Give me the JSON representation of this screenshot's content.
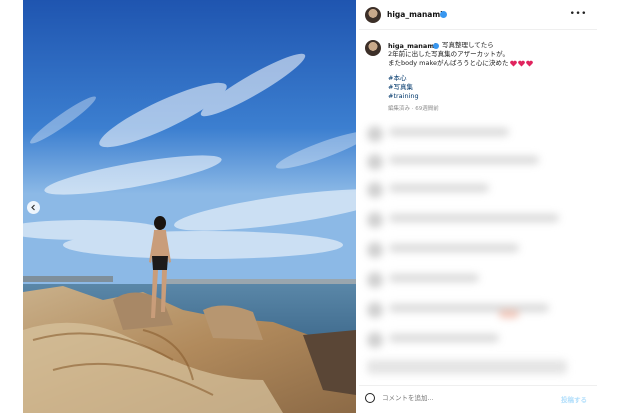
{
  "post": {
    "username": "higa_manami",
    "caption_lines": [
      "写真整理してたら",
      "2年前に出した写真集のアザーカットが。",
      "またbody makeがんばろうと心に決めた"
    ],
    "hashtags": [
      "#本心",
      "#写真集",
      "#training"
    ],
    "meta": "編集済み · 69週間前"
  },
  "header": {
    "more_icon": "more-horizontal-icon",
    "more_label": "•••"
  },
  "footer": {
    "comment_placeholder": "コメントを追加...",
    "post_label": "投稿する",
    "emoji_icon": "emoji-smiley-icon"
  },
  "colors": {
    "link": "#00376b",
    "verified": "#3897f0",
    "heart": "#e0245e"
  }
}
